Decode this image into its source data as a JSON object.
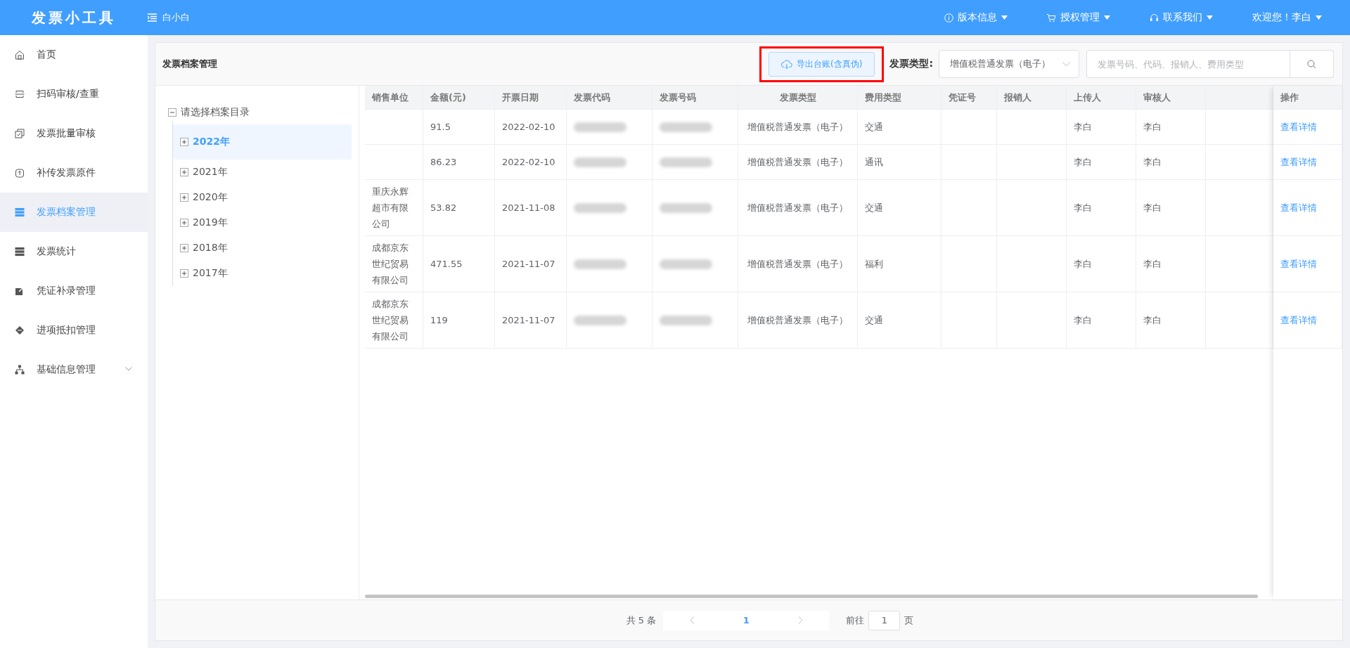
{
  "topbar": {
    "logo": "发票小工具",
    "user_toggle": "白小白",
    "menus": [
      {
        "label": "版本信息"
      },
      {
        "label": "授权管理"
      },
      {
        "label": "联系我们"
      }
    ],
    "welcome": "欢迎您！李白"
  },
  "sidebar": {
    "items": [
      {
        "label": "首页",
        "selected": false,
        "expandable": false
      },
      {
        "label": "扫码审核/查重",
        "selected": false,
        "expandable": false
      },
      {
        "label": "发票批量审核",
        "selected": false,
        "expandable": false
      },
      {
        "label": "补传发票原件",
        "selected": false,
        "expandable": false
      },
      {
        "label": "发票档案管理",
        "selected": true,
        "expandable": false
      },
      {
        "label": "发票统计",
        "selected": false,
        "expandable": false
      },
      {
        "label": "凭证补录管理",
        "selected": false,
        "expandable": false
      },
      {
        "label": "进项抵扣管理",
        "selected": false,
        "expandable": false
      },
      {
        "label": "基础信息管理",
        "selected": false,
        "expandable": true
      }
    ]
  },
  "page": {
    "title": "发票档案管理",
    "export_button": {
      "label": "导出台账(含真伪)",
      "highlighted": true
    },
    "type_filter": {
      "label": "发票类型:",
      "value": "增值税普通发票（电子）"
    },
    "search": {
      "placeholder": "发票号码、代码、报销人、费用类型"
    }
  },
  "tree": {
    "label": "请选择档案目录",
    "expanded": true,
    "children": [
      {
        "label": "2022年",
        "selected": true,
        "expanded": false
      },
      {
        "label": "2021年",
        "selected": false,
        "expanded": false
      },
      {
        "label": "2020年",
        "selected": false,
        "expanded": false
      },
      {
        "label": "2019年",
        "selected": false,
        "expanded": false
      },
      {
        "label": "2018年",
        "selected": false,
        "expanded": false
      },
      {
        "label": "2017年",
        "selected": false,
        "expanded": false
      }
    ]
  },
  "table": {
    "columns": [
      "销售单位",
      "金额(元)",
      "开票日期",
      "发票代码",
      "发票号码",
      "发票类型",
      "费用类型",
      "凭证号",
      "报销人",
      "上传人",
      "审核人",
      "操作"
    ],
    "rows": [
      {
        "amount": "91.5",
        "date": "2022-02-10",
        "code_redacted": true,
        "number_redacted": true,
        "type": "增值税普通发票（电子）",
        "expense": "交通",
        "uploader": "李白",
        "reviewer": "李白",
        "action": "查看详情"
      },
      {
        "amount": "86.23",
        "date": "2022-02-10",
        "code_redacted": true,
        "number_redacted": true,
        "type": "增值税普通发票（电子）",
        "expense": "通讯",
        "uploader": "李白",
        "reviewer": "李白",
        "action": "查看详情"
      },
      {
        "seller": "重庆永辉超市有限公司",
        "amount": "53.82",
        "date": "2021-11-08",
        "code_redacted": true,
        "number_redacted": true,
        "type": "增值税普通发票（电子）",
        "expense": "交通",
        "uploader": "李白",
        "reviewer": "李白",
        "action": "查看详情"
      },
      {
        "seller": "成都京东世纪贸易有限公司",
        "amount": "471.55",
        "date": "2021-11-07",
        "code_redacted": true,
        "number_redacted": true,
        "type": "增值税普通发票（电子）",
        "expense": "福利",
        "uploader": "李白",
        "reviewer": "李白",
        "action": "查看详情"
      },
      {
        "seller": "成都京东世纪贸易有限公司",
        "amount": "119",
        "date": "2021-11-07",
        "code_redacted": true,
        "number_redacted": true,
        "type": "增值税普通发票（电子）",
        "expense": "交通",
        "uploader": "李白",
        "reviewer": "李白",
        "action": "查看详情"
      }
    ]
  },
  "pagination": {
    "total": "共 5 条",
    "pages": [
      {
        "label": "1",
        "selected": true
      }
    ],
    "goto_label": "前往",
    "goto_value": "1",
    "goto_suffix": "页"
  }
}
